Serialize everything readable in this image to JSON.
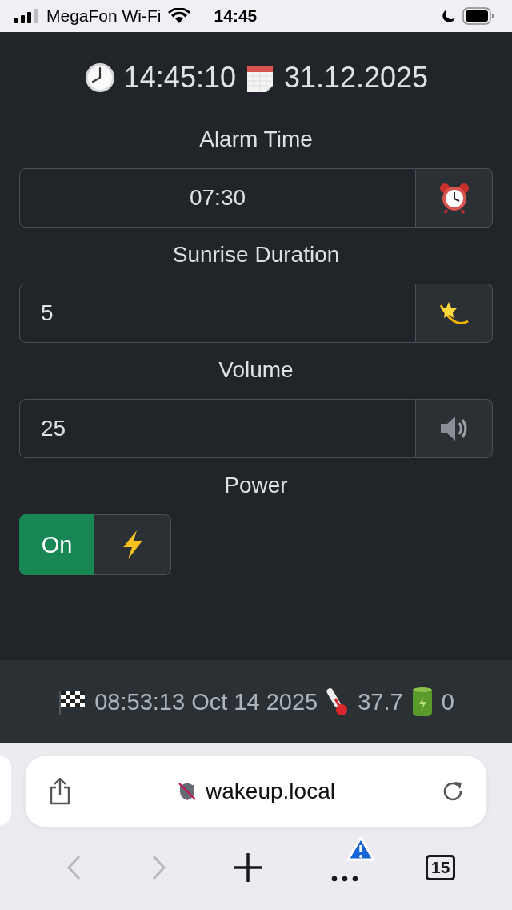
{
  "status_bar": {
    "carrier": "MegaFon Wi-Fi",
    "time": "14:45"
  },
  "header": {
    "time": "14:45:10",
    "date": "31.12.2025"
  },
  "fields": [
    {
      "label": "Alarm Time",
      "value": "07:30",
      "kind": "time"
    },
    {
      "label": "Sunrise Duration",
      "value": "5",
      "kind": "duration"
    },
    {
      "label": "Volume",
      "value": "25",
      "kind": "volume"
    }
  ],
  "power": {
    "label": "Power",
    "state": "On",
    "on": true
  },
  "footer": {
    "started": "08:53:13 Oct 14 2025",
    "temperature": "37.7",
    "battery": "0"
  },
  "browser": {
    "url": "wakeup.local",
    "tab_count": "15",
    "back_disabled": true,
    "forward_disabled": true,
    "alert": true
  }
}
